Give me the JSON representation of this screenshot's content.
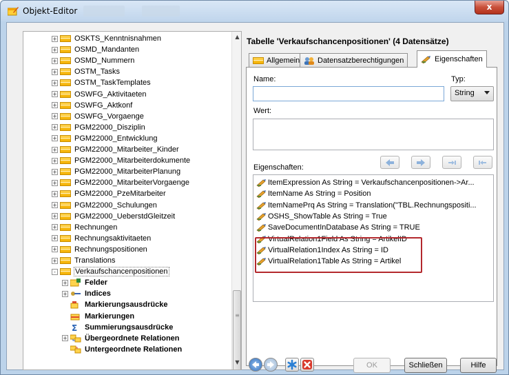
{
  "window": {
    "title": "Objekt-Editor",
    "close_label": "x"
  },
  "tree": {
    "items": [
      {
        "label": "OSKTS_Kenntnisnahmen",
        "expander": "+"
      },
      {
        "label": "OSMD_Mandanten",
        "expander": "+"
      },
      {
        "label": "OSMD_Nummern",
        "expander": "+"
      },
      {
        "label": "OSTM_Tasks",
        "expander": "+"
      },
      {
        "label": "OSTM_TaskTemplates",
        "expander": "+"
      },
      {
        "label": "OSWFG_Aktivitaeten",
        "expander": "+"
      },
      {
        "label": "OSWFG_Aktkonf",
        "expander": "+"
      },
      {
        "label": "OSWFG_Vorgaenge",
        "expander": "+"
      },
      {
        "label": "PGM22000_Disziplin",
        "expander": "+"
      },
      {
        "label": "PGM22000_Entwicklung",
        "expander": "+"
      },
      {
        "label": "PGM22000_Mitarbeiter_Kinder",
        "expander": "+"
      },
      {
        "label": "PGM22000_Mitarbeiterdokumente",
        "expander": "+"
      },
      {
        "label": "PGM22000_MitarbeiterPlanung",
        "expander": "+"
      },
      {
        "label": "PGM22000_MitarbeiterVorgaenge",
        "expander": "+"
      },
      {
        "label": "PGM22000_PzeMitarbeiter",
        "expander": "+"
      },
      {
        "label": "PGM22000_Schulungen",
        "expander": "+"
      },
      {
        "label": "PGM22000_UeberstdGleitzeit",
        "expander": "+"
      },
      {
        "label": "Rechnungen",
        "expander": "+"
      },
      {
        "label": "Rechnungsaktivitaeten",
        "expander": "+"
      },
      {
        "label": "Rechnungspositionen",
        "expander": "+"
      },
      {
        "label": "Translations",
        "expander": "+"
      },
      {
        "label": "Verkaufschancenpositionen",
        "expander": "-"
      }
    ],
    "children": [
      {
        "label": "Felder",
        "expander": "+",
        "icon": "fields-icon"
      },
      {
        "label": "Indices",
        "expander": "+",
        "icon": "key-icon"
      },
      {
        "label": "Markierungsausdrücke",
        "expander": "",
        "icon": "marker-expression-icon"
      },
      {
        "label": "Markierungen",
        "expander": "",
        "icon": "marker-icon"
      },
      {
        "label": "Summierungsausdrücke",
        "expander": "",
        "icon": "sum-icon"
      },
      {
        "label": "Übergeordnete Relationen",
        "expander": "+",
        "icon": "parent-relation-icon"
      },
      {
        "label": "Untergeordnete Relationen",
        "expander": "",
        "icon": "child-relation-icon"
      }
    ],
    "scrollbar_position": 0.75
  },
  "main": {
    "heading": "Tabelle 'Verkaufschancenpositionen' (4 Datensätze)",
    "tabs": [
      {
        "label": "Allgemein",
        "icon": "table-icon"
      },
      {
        "label": "Datensatzberechtigungen",
        "icon": "users-icon"
      },
      {
        "label": "Eigenschaften",
        "icon": "properties-icon",
        "active": true
      }
    ],
    "name_label": "Name:",
    "name_value": "",
    "type_label": "Typ:",
    "type_value": "String",
    "value_label": "Wert:",
    "value_value": "",
    "properties_label": "Eigenschaften:",
    "properties": [
      "ItemExpression As String = Verkaufschancenpositionen->Ar...",
      "ItemName As String = Position",
      "ItemNamePrq As String = Translation(\"TBL.Rechnungspositi...",
      "OSHS_ShowTable As String = True",
      "SaveDocumentInDatabase As String = TRUE",
      "VirtualRelation1Field As String = ArtikelID",
      "VirtualRelation1Index As String = ID",
      "VirtualRelation1Table As String = Artikel"
    ],
    "highlight_color": "#b3282d"
  },
  "buttons": {
    "ok": "OK",
    "close": "Schließen",
    "help": "Hilfe"
  }
}
